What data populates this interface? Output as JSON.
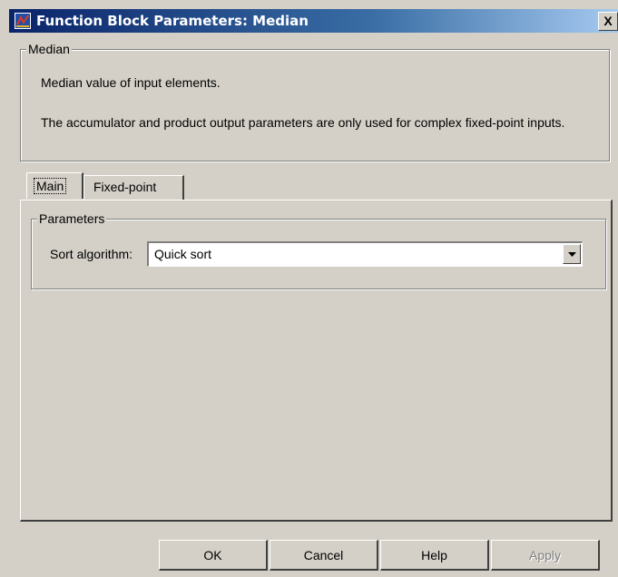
{
  "window": {
    "title": "Function Block Parameters: Median",
    "close_symbol": "X"
  },
  "block_group": {
    "legend": "Median",
    "description": "Median value of input elements.",
    "note": "The accumulator and product output parameters are only used for complex fixed-point inputs."
  },
  "tabs": [
    {
      "label": "Main",
      "selected": true
    },
    {
      "label": "Fixed-point",
      "selected": false
    }
  ],
  "parameters": {
    "legend": "Parameters",
    "sort_label": "Sort algorithm:",
    "sort_value": "Quick sort"
  },
  "buttons": {
    "ok": "OK",
    "cancel": "Cancel",
    "help": "Help",
    "apply": "Apply"
  },
  "icons": {
    "app": "simulink-block-icon",
    "close": "close-icon",
    "dropdown": "chevron-down-icon"
  }
}
